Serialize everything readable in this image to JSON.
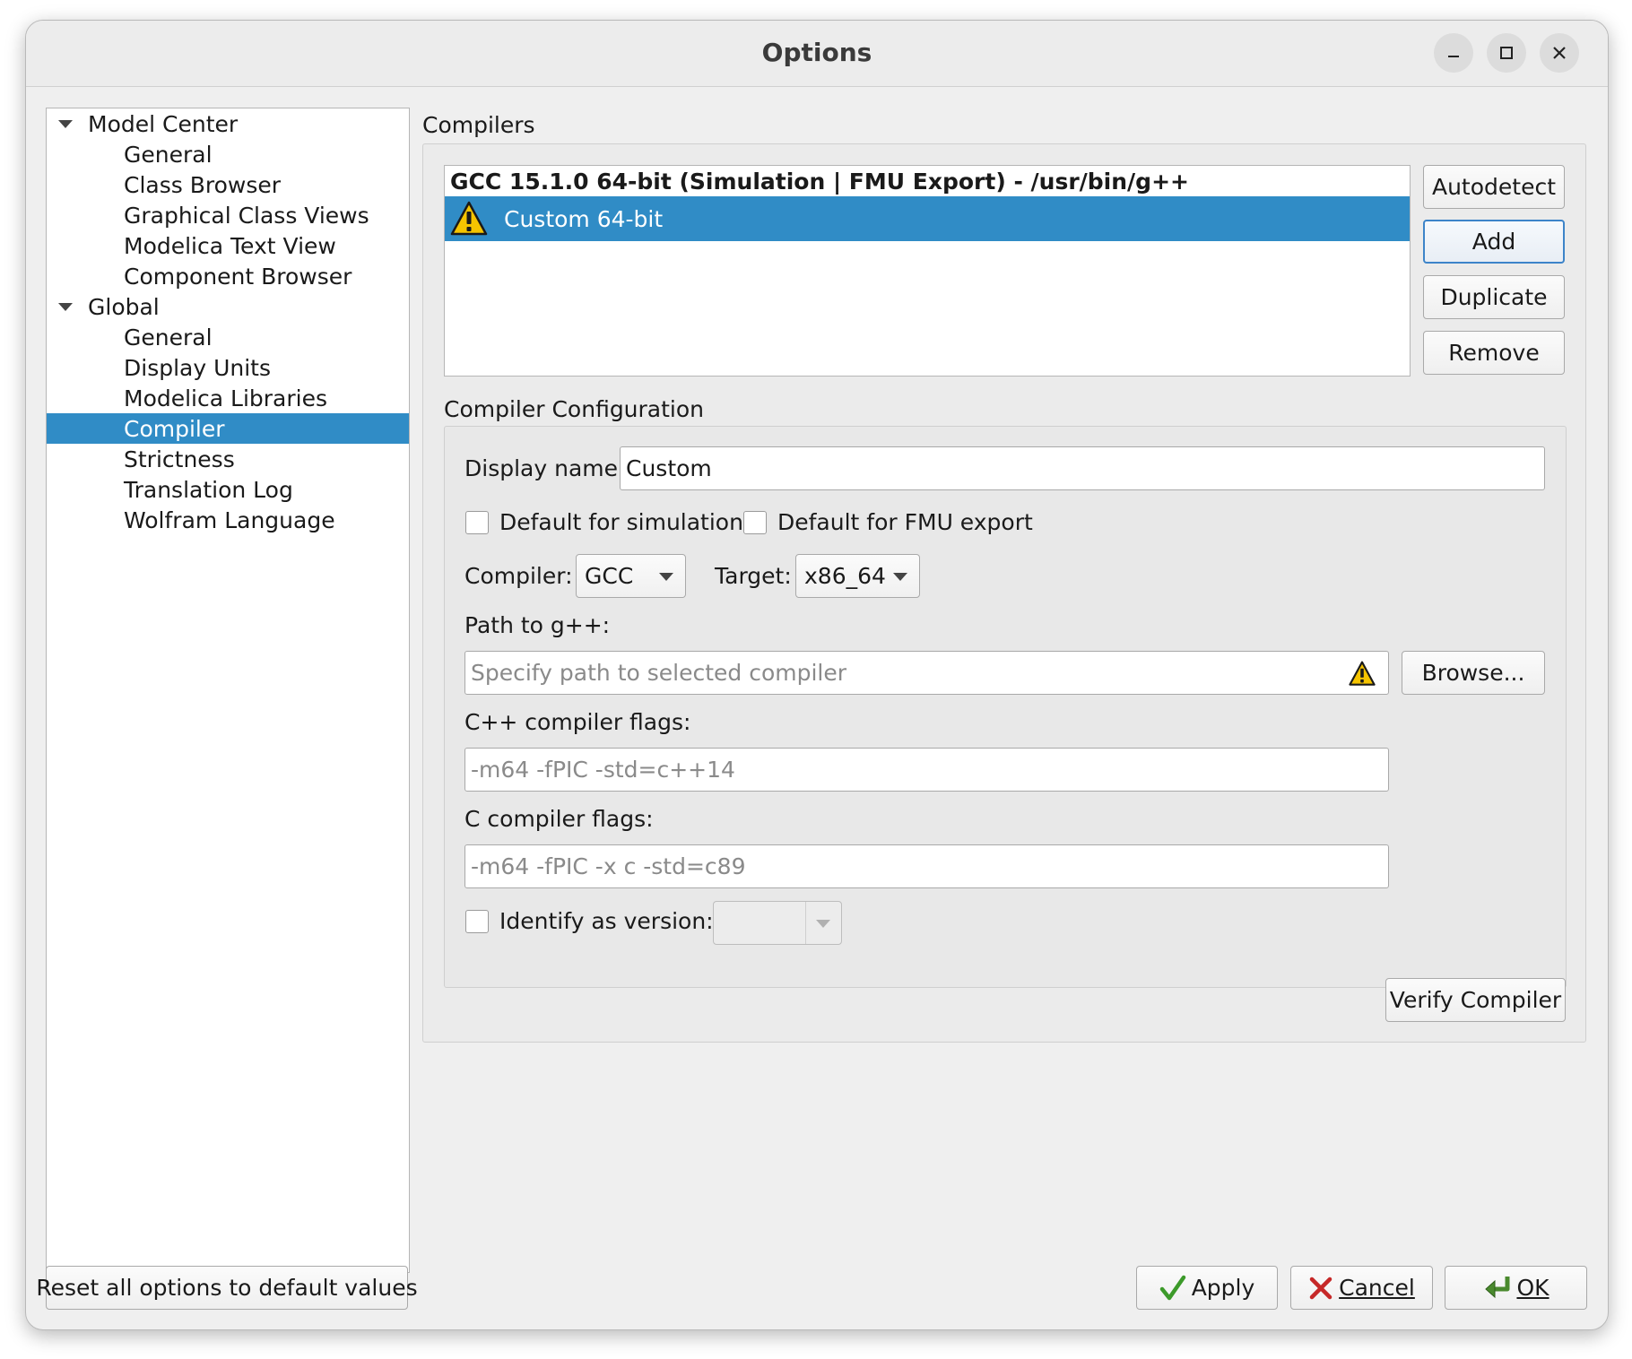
{
  "window": {
    "title": "Options"
  },
  "tree": {
    "items": [
      {
        "label": "Model Center",
        "level": 0,
        "expanded": true
      },
      {
        "label": "General",
        "level": 1
      },
      {
        "label": "Class Browser",
        "level": 1
      },
      {
        "label": "Graphical Class Views",
        "level": 1
      },
      {
        "label": "Modelica Text View",
        "level": 1
      },
      {
        "label": "Component Browser",
        "level": 1
      },
      {
        "label": "Global",
        "level": 0,
        "expanded": true
      },
      {
        "label": "General",
        "level": 1
      },
      {
        "label": "Display Units",
        "level": 1
      },
      {
        "label": "Modelica Libraries",
        "level": 1
      },
      {
        "label": "Compiler",
        "level": 1,
        "selected": true
      },
      {
        "label": "Strictness",
        "level": 1
      },
      {
        "label": "Translation Log",
        "level": 1
      },
      {
        "label": "Wolfram Language",
        "level": 1
      }
    ]
  },
  "compilers": {
    "section_label": "Compilers",
    "list": [
      {
        "label": "GCC 15.1.0 64-bit (Simulation | FMU Export) - /usr/bin/g++",
        "bold": true,
        "warning": false
      },
      {
        "label": "Custom 64-bit",
        "selected": true,
        "warning": true
      }
    ],
    "buttons": {
      "autodetect": "Autodetect",
      "add": "Add",
      "duplicate": "Duplicate",
      "remove": "Remove"
    }
  },
  "config": {
    "section_label": "Compiler Configuration",
    "display_name_label": "Display name:",
    "display_name_value": "Custom",
    "default_simulation_label": "Default for simulation",
    "default_fmu_label": "Default for FMU export",
    "compiler_label": "Compiler:",
    "compiler_value": "GCC",
    "target_label": "Target:",
    "target_value": "x86_64",
    "path_label": "Path to g++:",
    "path_placeholder": "Specify path to selected compiler",
    "browse_button": "Browse...",
    "cpp_flags_label": "C++ compiler flags:",
    "cpp_flags_placeholder": "-m64 -fPIC -std=c++14",
    "c_flags_label": "C compiler flags:",
    "c_flags_placeholder": "-m64 -fPIC -x c -std=c89",
    "identify_label": "Identify as version:",
    "identify_value": "",
    "verify_button": "Verify Compiler"
  },
  "footer": {
    "reset_button": "Reset all options to default values",
    "apply_button": "Apply",
    "cancel_button": "Cancel",
    "ok_button": "OK"
  },
  "colors": {
    "selection": "#308cc6",
    "warning": "#f5c400",
    "apply_check": "#3c9a2a",
    "cancel_x": "#c62828"
  }
}
